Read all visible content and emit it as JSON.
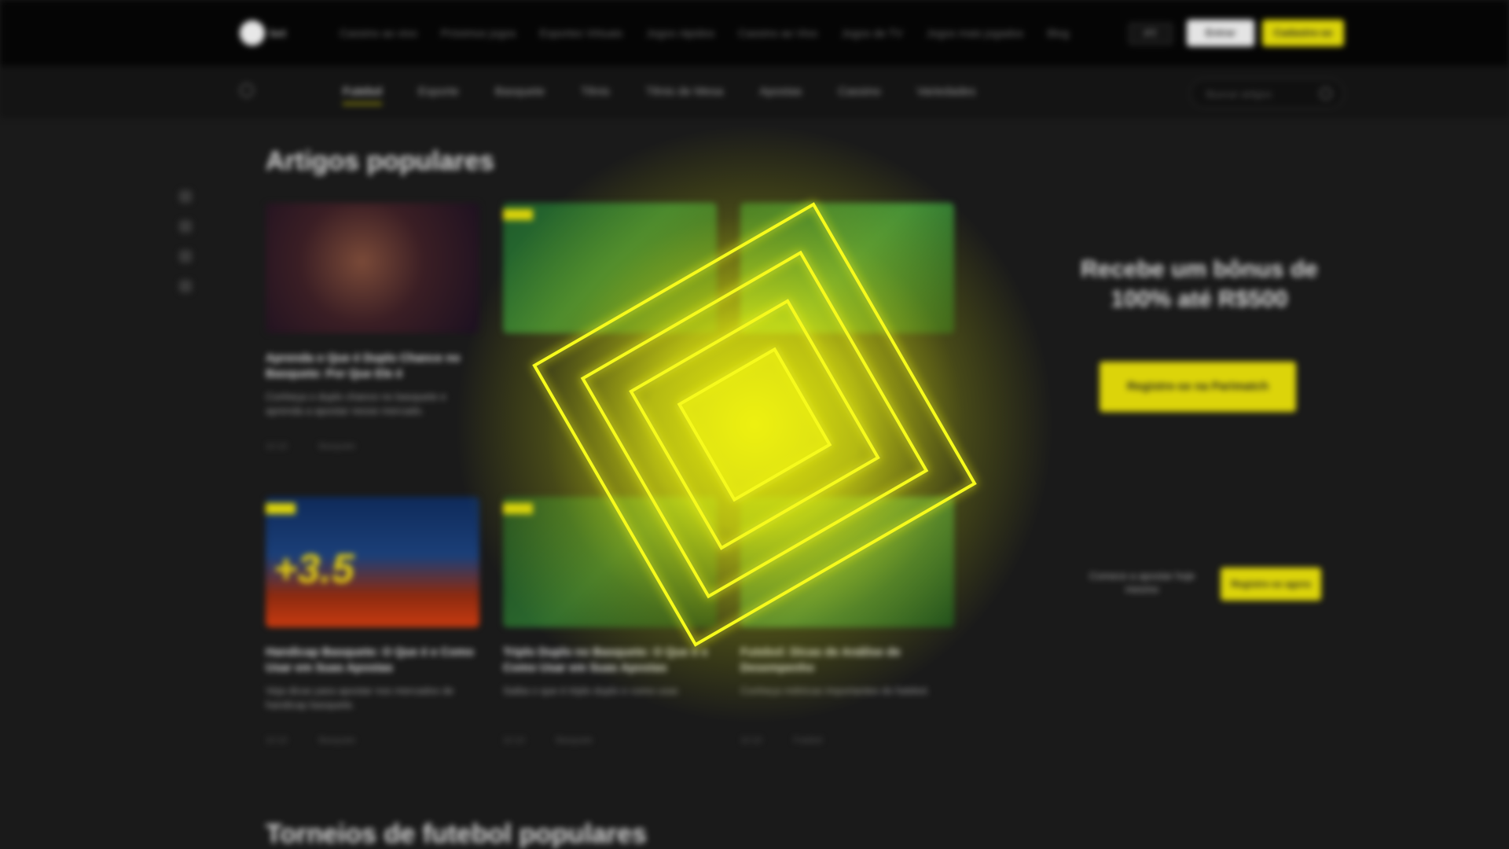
{
  "header": {
    "logo_text": "bet",
    "nav": [
      "Cassino ao vivo",
      "Próximos jogos",
      "Esportes Virtuais",
      "Jogos rápidos",
      "Cassino ao Vivo",
      "Jogos de TV",
      "Jogos mais jogados",
      "Blog"
    ],
    "lang": "PT",
    "login_label": "Entrar",
    "register_label": "Cadastre-se"
  },
  "subnav": {
    "items": [
      "Futebol",
      "Esporte",
      "Basquete",
      "Tênis",
      "Tênis de Mesa",
      "Apostas",
      "Cassino",
      "Variedades"
    ],
    "search_placeholder": "Buscar artigos"
  },
  "main": {
    "section1_title": "Artigos populares",
    "section2_title": "Torneios de futebol populares",
    "cards": [
      {
        "title": "Aprenda o Que é Duplo Chance no Basquete: Por Que Ele é",
        "desc": "Conheça o duplo chance no basquete e aprenda a apostar nesse mercado.",
        "date": "10.10",
        "tag": "Basquete"
      },
      {
        "title": "",
        "desc": "",
        "date": "",
        "tag": ""
      },
      {
        "title": "",
        "desc": "",
        "date": "",
        "tag": ""
      },
      {
        "title": "Handicap Basquete: O Que é e Como Usar em Suas Apostas",
        "desc": "Veja dicas para apostar nos mercados de handicap basquete.",
        "date": "10.10",
        "tag": "Basquete",
        "big_number": "+3.5"
      },
      {
        "title": "Triplo Duplo no Basquete: O Que é e Como Usar em Suas Apostas",
        "desc": "Saiba o que é triplo duplo e como usar.",
        "date": "10.10",
        "tag": "Basquete"
      },
      {
        "title": "Futebol: Dicas de Análise de Desempenho",
        "desc": "Conheça métricas importantes do futebol.",
        "date": "10.10",
        "tag": "Futebol"
      }
    ]
  },
  "promo": {
    "headline": "Recebe um bônus de 100% até R$500",
    "cta": "Registre-se na Parimatch",
    "small_text": "Comece a apostar hoje mesmo",
    "small_cta": "Registre-se agora"
  },
  "colors": {
    "accent": "#dcd40a",
    "background": "#1a1a1a",
    "loader": "#f4f80a"
  }
}
